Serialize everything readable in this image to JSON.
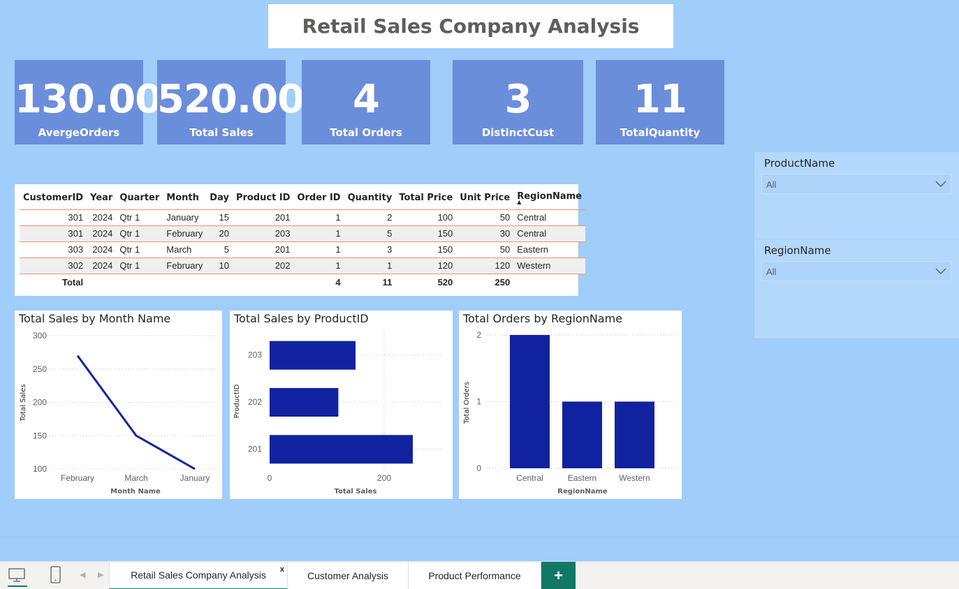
{
  "report_title": "Retail Sales Company Analysis",
  "kpis": [
    {
      "value": "130.00",
      "label": "AvergeOrders"
    },
    {
      "value": "520.00",
      "label": "Total Sales"
    },
    {
      "value": "4",
      "label": "Total Orders"
    },
    {
      "value": "3",
      "label": "DistinctCust"
    },
    {
      "value": "11",
      "label": "TotalQuantity"
    }
  ],
  "table": {
    "columns": [
      "CustomerID",
      "Year",
      "Quarter",
      "Month",
      "Day",
      "Product ID",
      "Order ID",
      "Quantity",
      "Total Price",
      "Unit Price",
      "RegionName"
    ],
    "rows": [
      [
        "301",
        "2024",
        "Qtr 1",
        "January",
        "15",
        "201",
        "1",
        "2",
        "100",
        "50",
        "Central"
      ],
      [
        "301",
        "2024",
        "Qtr 1",
        "February",
        "20",
        "203",
        "1",
        "5",
        "150",
        "30",
        "Central"
      ],
      [
        "303",
        "2024",
        "Qtr 1",
        "March",
        "5",
        "201",
        "1",
        "3",
        "150",
        "50",
        "Eastern"
      ],
      [
        "302",
        "2024",
        "Qtr 1",
        "February",
        "10",
        "202",
        "1",
        "1",
        "120",
        "120",
        "Western"
      ]
    ],
    "total": {
      "label": "Total",
      "order_id": "4",
      "quantity": "11",
      "total_price": "520",
      "unit_price": "250"
    }
  },
  "slicers": [
    {
      "title": "ProductName",
      "value": "All"
    },
    {
      "title": "RegionName",
      "value": "All"
    }
  ],
  "tabs": [
    {
      "label": "Retail Sales Company Analysis",
      "close": "x"
    },
    {
      "label": "Customer Analysis"
    },
    {
      "label": "Product Performance"
    }
  ],
  "add_tab_label": "+",
  "colors": {
    "background": "#a0cdfa",
    "card": "#6b8edb",
    "series": "#1122a0",
    "tab_accent": "#117865"
  },
  "chart_data": [
    {
      "type": "line",
      "title": "Total Sales by Month Name",
      "categories": [
        "February",
        "March",
        "January"
      ],
      "values": [
        270,
        150,
        100
      ],
      "xlabel": "Month Name",
      "ylabel": "Total Sales",
      "ylim": [
        100,
        300
      ],
      "yticks": [
        100,
        150,
        200,
        250,
        300
      ],
      "grid": true
    },
    {
      "type": "bar",
      "orientation": "horizontal",
      "title": "Total Sales by ProductID",
      "categories": [
        "203",
        "202",
        "201"
      ],
      "values": [
        150,
        120,
        250
      ],
      "xlabel": "Total Sales",
      "ylabel": "ProductID",
      "xlim": [
        0,
        300
      ],
      "xticks": [
        0,
        200
      ],
      "grid": true
    },
    {
      "type": "bar",
      "title": "Total Orders by RegionName",
      "categories": [
        "Central",
        "Eastern",
        "Western"
      ],
      "values": [
        2,
        1,
        1
      ],
      "xlabel": "RegionName",
      "ylabel": "Total Orders",
      "ylim": [
        0,
        2
      ],
      "yticks": [
        0,
        1,
        2
      ],
      "grid": true
    }
  ]
}
